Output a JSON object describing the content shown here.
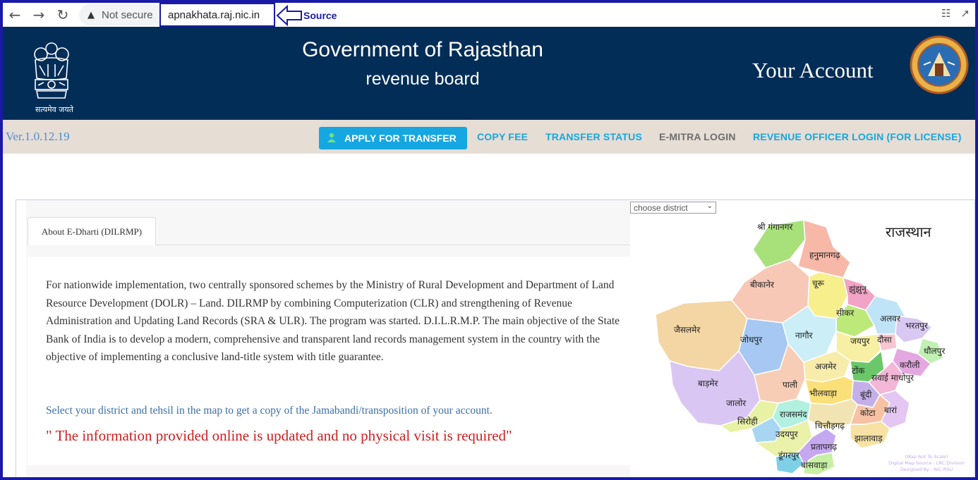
{
  "browser": {
    "security_text": "Not secure",
    "url": "apnakhata.raj.nic.in",
    "annotation": "Source"
  },
  "header": {
    "motto": "सत्यमेव जयते",
    "title": "Government of Rajasthan",
    "subtitle": "revenue board",
    "account": "Your Account"
  },
  "nav": {
    "version": "Ver.1.0.12.19",
    "apply": "APPLY FOR TRANSFER",
    "copy_fee": "COPY FEE",
    "transfer_status": "TRANSFER STATUS",
    "emitra": "E-MITRA LOGIN",
    "revenue_officer": "REVENUE OFFICER LOGIN (FOR LICENSE)"
  },
  "content": {
    "tab": "About E-Dharti (DILRMP)",
    "paragraph": "For nationwide implementation, two centrally sponsored schemes by the Ministry of Rural Development and Department of Land Resource Development (DOLR) – Land. DILRMP by combining Computerization (CLR) and strengthening of Revenue Administration and Updating Land Records (SRA & ULR). The program was started. D.I.L.R.M.P. The main objective of the State Bank of India is to develop a modern, comprehensive and transparent land records management system in the country with the objective of implementing a conclusive land-title system with title guarantee.",
    "select_msg": "Select your district and tehsil in the map to get a copy of the Jamabandi/transposition of your account.",
    "red_msg": "\" The information provided online is updated and no physical visit is required\""
  },
  "map": {
    "select_placeholder": "choose district",
    "state_title": "राजस्थान",
    "districts": {
      "ganganagar": "श्री गंगानगर",
      "hanumangarh": "हनुमानगढ़",
      "bikaner": "बीकानेर",
      "churu": "चूरू",
      "jhunjhunu": "झुंझुनू",
      "sikar": "सीकर",
      "alwar": "अलवर",
      "bharatpur": "भरतपुर",
      "jaisalmer": "जैसलमेर",
      "jodhpur": "जोधपुर",
      "nagaur": "नागौर",
      "jaipur": "जयपुर",
      "dausa": "दौसा",
      "dholpur": "धौलपुर",
      "karauli": "करौली",
      "ajmer": "अजमेर",
      "tonk": "टोंक",
      "sawai_madhopur": "सवाई माधोपुर",
      "barmer": "बाड़मेर",
      "pali": "पाली",
      "bhilwara": "भीलवाड़ा",
      "bundi": "बूंदी",
      "jalore": "जालोर",
      "sirohi": "सिरोही",
      "rajsamand": "राजसमंद",
      "chittorgarh": "चित्तौड़गढ़",
      "kota": "कोटा",
      "baran": "बारां",
      "udaipur": "उदयपुर",
      "jhalawar": "झालावाड़",
      "dungarpur": "डूंगरपुर",
      "pratapgarh": "प्रतापगढ़",
      "banswara": "बांसवाड़ा"
    },
    "footer1": "(Map Not To Scale)",
    "footer2": "Digital Map Source : LRC Division",
    "footer3": "Designed By : NIC-RSU"
  }
}
